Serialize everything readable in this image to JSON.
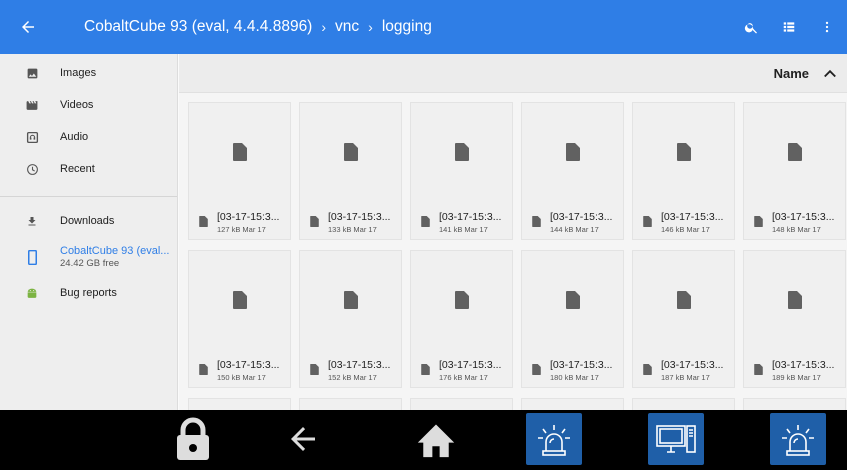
{
  "topbar": {
    "crumbs": [
      {
        "label": "CobaltCube 93 (eval, 4.4.4.8896)"
      },
      {
        "label": "vnc"
      },
      {
        "label": "logging"
      }
    ],
    "separator": "›"
  },
  "sidebar": {
    "items": [
      {
        "label": "Images",
        "icon": "image-icon"
      },
      {
        "label": "Videos",
        "icon": "video-icon"
      },
      {
        "label": "Audio",
        "icon": "audio-icon"
      },
      {
        "label": "Recent",
        "icon": "clock-icon"
      }
    ],
    "downloads": {
      "label": "Downloads",
      "icon": "download-icon"
    },
    "storage": {
      "label": "CobaltCube 93 (eval...",
      "sub": "24.42 GB free",
      "icon": "phone-icon"
    },
    "bugreports": {
      "label": "Bug reports",
      "icon": "android-icon"
    }
  },
  "sort": {
    "label": "Name",
    "direction": "ascending"
  },
  "files": [
    {
      "name": "[03-17-15:3...",
      "info": "127 kB Mar 17"
    },
    {
      "name": "[03-17-15:3...",
      "info": "133 kB Mar 17"
    },
    {
      "name": "[03-17-15:3...",
      "info": "141 kB Mar 17"
    },
    {
      "name": "[03-17-15:3...",
      "info": "144 kB Mar 17"
    },
    {
      "name": "[03-17-15:3...",
      "info": "146 kB Mar 17"
    },
    {
      "name": "[03-17-15:3...",
      "info": "148 kB Mar 17"
    },
    {
      "name": "[03-17-15:3...",
      "info": "150 kB Mar 17"
    },
    {
      "name": "[03-17-15:3...",
      "info": "152 kB Mar 17"
    },
    {
      "name": "[03-17-15:3...",
      "info": "176 kB Mar 17"
    },
    {
      "name": "[03-17-15:3...",
      "info": "180 kB Mar 17"
    },
    {
      "name": "[03-17-15:3...",
      "info": "187 kB Mar 17"
    },
    {
      "name": "[03-17-15:3...",
      "info": "189 kB Mar 17"
    }
  ],
  "taskbar": {
    "icons": [
      "lock-icon",
      "back-arrow-icon",
      "home-icon",
      "alarm-icon",
      "remote-desktop-icon",
      "alarm-icon"
    ]
  },
  "colors": {
    "accent": "#2f7ee6",
    "taskbar_button": "#1f5fa8"
  }
}
